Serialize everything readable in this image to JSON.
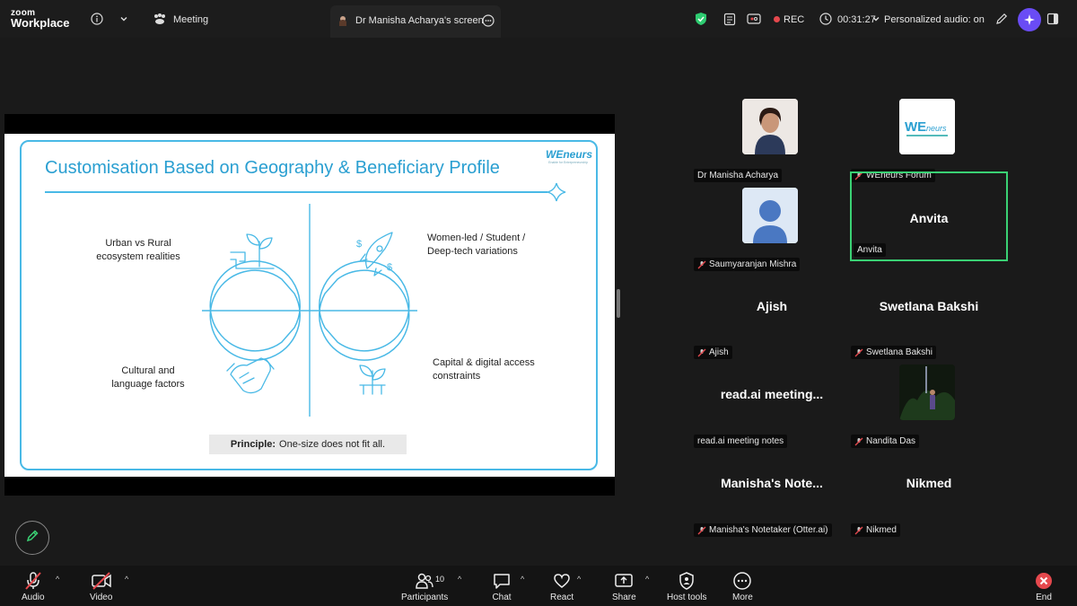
{
  "topbar": {
    "brand_small": "zoom",
    "brand_large": "Workplace",
    "meeting_label": "Meeting",
    "share_tab_label": "Dr Manisha Acharya's screen",
    "rec_label": "REC",
    "timer": "00:31:27",
    "audio_mode": "Personalized audio: on"
  },
  "slide": {
    "title": "Customisation Based on Geography & Beneficiary Profile",
    "logo_text": "WEneurs",
    "logo_tagline": "Enable for Entrepreneurship",
    "quad_top_left": [
      "Urban vs Rural",
      "ecosystem realities"
    ],
    "quad_top_right": [
      "Women-led / Student /",
      "Deep-tech variations"
    ],
    "quad_bottom_left": [
      "Cultural and",
      "language factors"
    ],
    "quad_bottom_right": [
      "Capital & digital access",
      "constraints"
    ],
    "principle_bold": "Principle:",
    "principle_text": "One-size does not fit all."
  },
  "participants": [
    {
      "name": "Dr Manisha Acharya",
      "muted": false,
      "tile_name": "",
      "avatar": "photo"
    },
    {
      "name": "WEneurs Forum",
      "muted": true,
      "tile_name": "",
      "avatar": "logo"
    },
    {
      "name": "Saumyaranjan Mishra",
      "muted": true,
      "tile_name": "",
      "avatar": "silhouette"
    },
    {
      "name": "Anvita",
      "muted": false,
      "tile_name": "Anvita",
      "avatar": "none"
    },
    {
      "name": "Ajish",
      "muted": true,
      "tile_name": "Ajish",
      "avatar": "none"
    },
    {
      "name": "Swetlana Bakshi",
      "muted": true,
      "tile_name": "Swetlana Bakshi",
      "avatar": "none"
    },
    {
      "name": "read.ai meeting notes",
      "muted": false,
      "tile_name": "read.ai meeting...",
      "avatar": "none"
    },
    {
      "name": "Nandita Das",
      "muted": true,
      "tile_name": "",
      "avatar": "night-photo"
    },
    {
      "name": "Manisha's Notetaker (Otter.ai)",
      "muted": true,
      "tile_name": "Manisha's Note...",
      "avatar": "none"
    },
    {
      "name": "Nikmed",
      "muted": true,
      "tile_name": "Nikmed",
      "avatar": "none"
    }
  ],
  "toolbar": {
    "audio": "Audio",
    "video": "Video",
    "participants": "Participants",
    "participants_count": "10",
    "chat": "Chat",
    "react": "React",
    "share": "Share",
    "host_tools": "Host tools",
    "more": "More",
    "end": "End"
  },
  "colors": {
    "accent_blue": "#49b9e6",
    "active_speaker": "#3ad174",
    "rec_red": "#e5484d",
    "end_red": "#e5484d",
    "ai_purple": "#6a4cf5"
  },
  "icons": [
    "info-icon",
    "chevron-down-icon",
    "meeting-icon",
    "share-screen-icon",
    "more-dots-icon",
    "shield-icon",
    "notes-icon",
    "captions-icon",
    "clock-icon",
    "pencil-icon",
    "ai-companion-icon",
    "layout-icon",
    "mic-muted-icon",
    "video-off-icon",
    "participants-icon",
    "chat-icon",
    "react-icon",
    "share-icon",
    "host-tools-icon",
    "more-icon",
    "end-icon"
  ]
}
